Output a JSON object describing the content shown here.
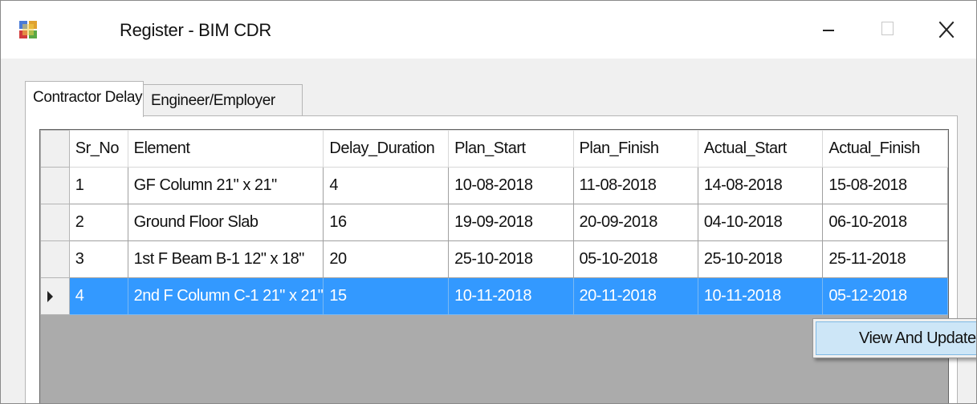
{
  "window": {
    "title": "Register - BIM CDR",
    "controls": {
      "minimize_icon": "minimize-icon",
      "maximize_icon": "maximize-icon",
      "close_icon": "close-icon"
    }
  },
  "tabs": [
    {
      "label": "Contractor Delay",
      "selected": true
    },
    {
      "label": "Engineer/Employer Delay",
      "selected": false
    }
  ],
  "grid": {
    "columns": [
      "Sr_No",
      "Element",
      "Delay_Duration",
      "Plan_Start",
      "Plan_Finish",
      "Actual_Start",
      "Actual_Finish"
    ],
    "rows": [
      [
        "1",
        "GF Column 21\" x 21\"",
        "4",
        "10-08-2018",
        "11-08-2018",
        "14-08-2018",
        "15-08-2018"
      ],
      [
        "2",
        "Ground Floor Slab",
        "16",
        "19-09-2018",
        "20-09-2018",
        "04-10-2018",
        "06-10-2018"
      ],
      [
        "3",
        "1st F Beam B-1 12\" x 18\"",
        "20",
        "25-10-2018",
        "05-10-2018",
        "25-10-2018",
        "25-11-2018"
      ],
      [
        "4",
        "2nd F Column C-1 21\" x 21\"",
        "15",
        "10-11-2018",
        "20-11-2018",
        "10-11-2018",
        "05-12-2018"
      ]
    ],
    "selected_row_index": 3,
    "selection_color": "#3399ff"
  },
  "context_menu": {
    "items": [
      {
        "label": "View And Update"
      }
    ]
  }
}
